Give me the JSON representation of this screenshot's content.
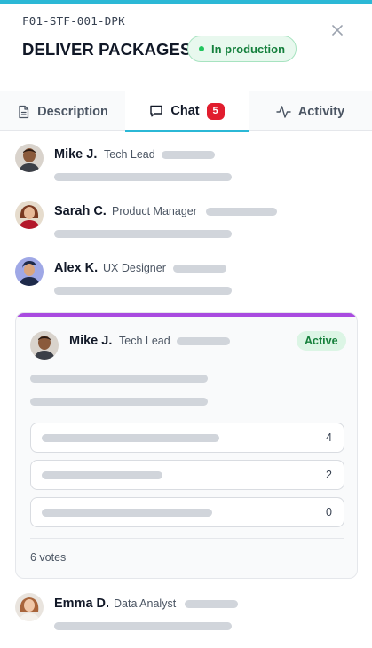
{
  "header": {
    "code": "F01-STF-001-DPK",
    "title": "DELIVER PACKAGES",
    "status": "In production"
  },
  "tabs": [
    {
      "label": "Description",
      "icon": "document-icon"
    },
    {
      "label": "Chat",
      "icon": "chat-bubble-icon",
      "badge": "5"
    },
    {
      "label": "Activity",
      "icon": "activity-pulse-icon"
    }
  ],
  "messages": [
    {
      "author": "Mike J.",
      "role": "Tech Lead"
    },
    {
      "author": "Sarah C.",
      "role": "Product Manager"
    },
    {
      "author": "Alex K.",
      "role": "UX Designer"
    }
  ],
  "poll": {
    "author": "Mike J.",
    "role": "Tech Lead",
    "status": "Active",
    "options": [
      {
        "count": "4"
      },
      {
        "count": "2"
      },
      {
        "count": "0"
      }
    ],
    "votes": "6 votes"
  },
  "last_message": {
    "author": "Emma D.",
    "role": "Data Analyst"
  },
  "colors": {
    "accent": "#2bb8d6",
    "poll_accent": "#a94be0",
    "badge_red": "#e11d2e",
    "success": "#15803d"
  }
}
